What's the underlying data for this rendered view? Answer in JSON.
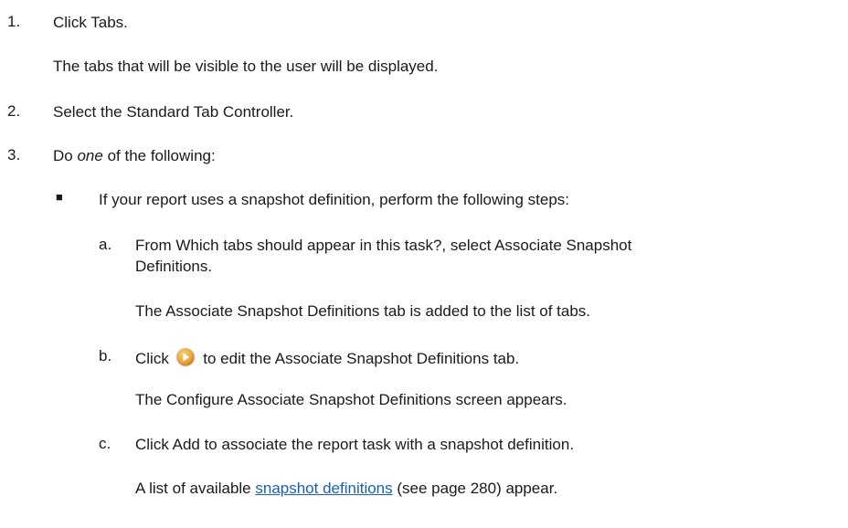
{
  "steps": {
    "s1": {
      "num": "1.",
      "text": "Click Tabs.",
      "result": "The tabs that will be visible to the user will be displayed."
    },
    "s2": {
      "num": "2.",
      "text": "Select the Standard Tab Controller."
    },
    "s3": {
      "num": "3.",
      "pre": "Do ",
      "em": "one",
      "post": " of the following:"
    }
  },
  "bullet": {
    "mark": "■",
    "text": "If your report uses a snapshot definition, perform the following steps:"
  },
  "substeps": {
    "a": {
      "letter": "a.",
      "line1": "From Which tabs should appear in this task?, select Associate Snapshot",
      "line2": "Definitions.",
      "result": "The Associate Snapshot Definitions tab is added to the list of tabs."
    },
    "b": {
      "letter": "b.",
      "pre": "Click",
      "icon": "edit-arrow-icon",
      "post": "to edit the Associate Snapshot Definitions tab.",
      "result": "The Configure Associate Snapshot Definitions screen appears."
    },
    "c": {
      "letter": "c.",
      "text": "Click Add to associate the report task with a snapshot definition.",
      "result_pre": "A list of available ",
      "result_link": "snapshot definitions",
      "result_post": " (see page 280) appear."
    }
  },
  "colors": {
    "text": "#1a1a1a",
    "link": "#1a5fb4",
    "icon": "#e8a33a"
  }
}
